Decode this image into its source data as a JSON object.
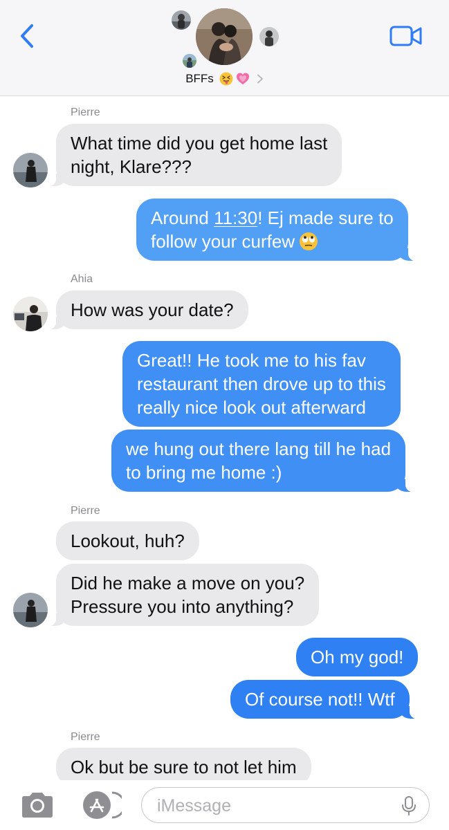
{
  "header": {
    "back_icon": "chevron-left-icon",
    "video_icon": "video-camera-icon",
    "group_name": "BFFs",
    "title_emojis": [
      "squinting-face-tongue",
      "growing-heart"
    ],
    "accent_color": "#2f7cf6"
  },
  "messages": [
    {
      "sender": "Pierre",
      "direction": "incoming",
      "lines": [
        "What time did you get home last",
        "night, Klare???"
      ]
    },
    {
      "direction": "outgoing",
      "line1_prefix": "Around ",
      "line1_time": "11:30",
      "line1_suffix": "! Ej made sure to",
      "line2": "follow your curfew"
    },
    {
      "sender": "Ahia",
      "direction": "incoming",
      "lines": [
        "How was your date?"
      ]
    },
    {
      "direction": "outgoing",
      "lines": [
        "Great!! He took me to his fav",
        "restaurant then drove up to this",
        "really nice look out afterward"
      ]
    },
    {
      "direction": "outgoing",
      "lines": [
        "we hung out there lang till he had",
        "to bring me home :)"
      ]
    },
    {
      "sender": "Pierre",
      "direction": "incoming",
      "lines": [
        "Lookout, huh?"
      ]
    },
    {
      "direction": "incoming",
      "lines": [
        "Did he make a move on you?",
        "Pressure you into anything?"
      ]
    },
    {
      "direction": "outgoing",
      "lines": [
        "Oh my god!"
      ]
    },
    {
      "direction": "outgoing",
      "lines": [
        "Of course not!! Wtf"
      ]
    },
    {
      "sender": "Pierre",
      "direction": "incoming",
      "lines": [
        "Ok but be sure to not let him"
      ]
    }
  ],
  "composer": {
    "placeholder": "iMessage",
    "camera_icon": "camera-icon",
    "apps_icon": "app-store-icon",
    "mic_icon": "microphone-icon"
  },
  "colors": {
    "incoming_bubble": "#e9e9eb",
    "outgoing_bubble_light": "#52a0f6",
    "outgoing_bubble_mid": "#3f8ff5",
    "outgoing_bubble_dark": "#2f80f3",
    "sender_label": "#8a8a8e"
  }
}
